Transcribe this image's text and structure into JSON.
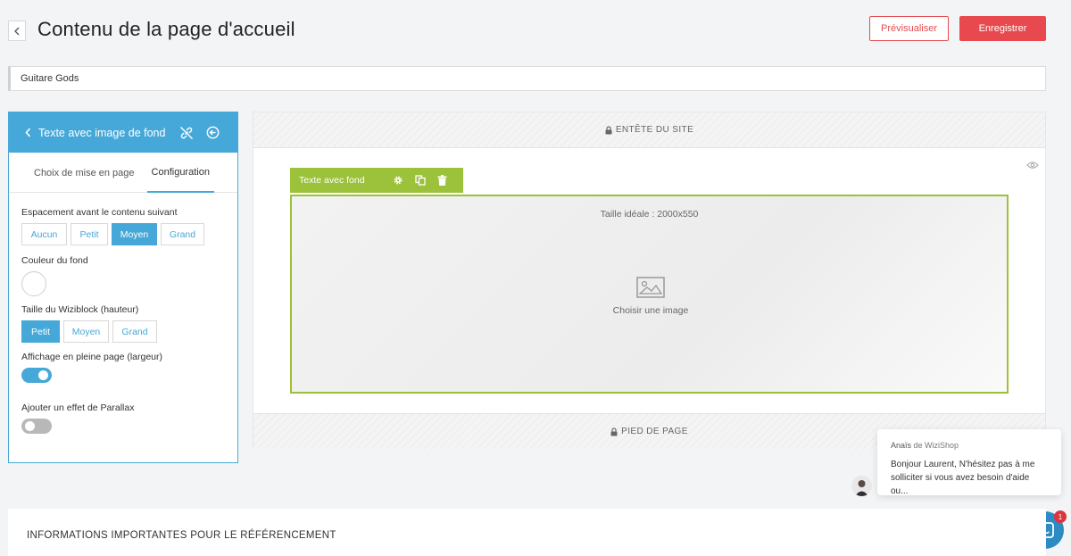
{
  "header": {
    "title": "Contenu de la page d'accueil",
    "preview_label": "Prévisualiser",
    "save_label": "Enregistrer"
  },
  "shop_name": {
    "value": "Guitare Gods"
  },
  "panel": {
    "title": "Texte avec image de fond",
    "tabs": [
      {
        "label": "Choix de mise en page",
        "active": false
      },
      {
        "label": "Configuration",
        "active": true
      }
    ],
    "spacing": {
      "label": "Espacement avant le contenu suivant",
      "options": [
        "Aucun",
        "Petit",
        "Moyen",
        "Grand"
      ],
      "selected": "Moyen"
    },
    "background_color": {
      "label": "Couleur du fond",
      "value": "#ffffff"
    },
    "height": {
      "label": "Taille du Wiziblock (hauteur)",
      "options": [
        "Petit",
        "Moyen",
        "Grand"
      ],
      "selected": "Petit"
    },
    "full_width": {
      "label": "Affichage en pleine page (largeur)",
      "enabled": true
    },
    "parallax": {
      "label": "Ajouter un effet de Parallax",
      "enabled": false
    }
  },
  "preview": {
    "header_band": "ENTÊTE DU SITE",
    "footer_band": "PIED DE PAGE",
    "block": {
      "label": "Texte avec fond",
      "ideal_size": "Taille idéale : 2000x550",
      "choose_image": "Choisir une image"
    }
  },
  "chat": {
    "sender_name": "Anaïs",
    "sender_suffix": "de WiziShop",
    "message_line1": "Bonjour Laurent, N'hésitez pas à me",
    "message_line2": "solliciter si vous avez besoin d'aide ou...",
    "badge_count": "1"
  },
  "seo": {
    "title": "INFORMATIONS IMPORTANTES POUR LE RÉFÉRENCEMENT"
  },
  "colors": {
    "accent_blue": "#46a8d8",
    "accent_red": "#e8494f",
    "block_green": "#9cc13a"
  }
}
